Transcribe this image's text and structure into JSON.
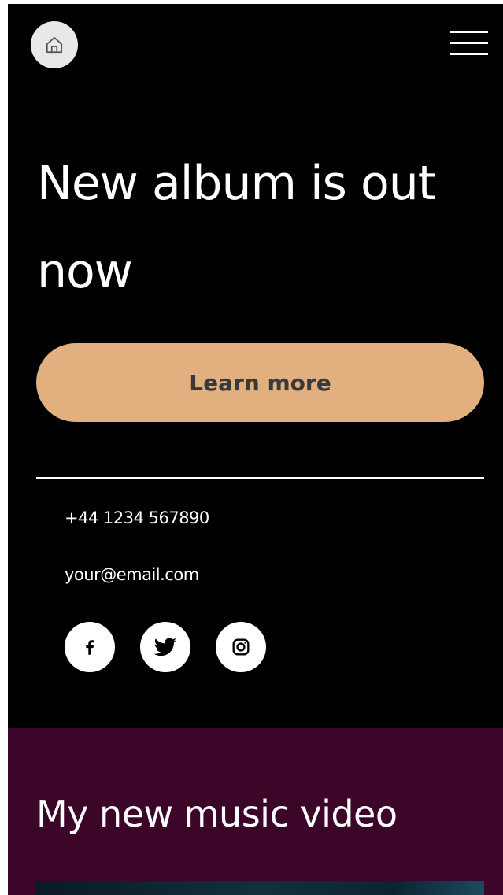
{
  "header": {
    "home_icon": "home-icon",
    "menu_icon": "hamburger-menu-icon"
  },
  "hero": {
    "title": "New album is out now",
    "cta_label": "Learn more"
  },
  "contact": {
    "phone": "+44 1234 567890",
    "email": "your@email.com"
  },
  "social": [
    {
      "name": "facebook",
      "icon": "facebook-icon"
    },
    {
      "name": "twitter",
      "icon": "twitter-icon"
    },
    {
      "name": "instagram",
      "icon": "instagram-icon"
    }
  ],
  "music": {
    "title": "My new music video"
  },
  "colors": {
    "page_bg": "#000000",
    "accent": "#e2b07f",
    "music_section_bg": "#3b0628"
  }
}
